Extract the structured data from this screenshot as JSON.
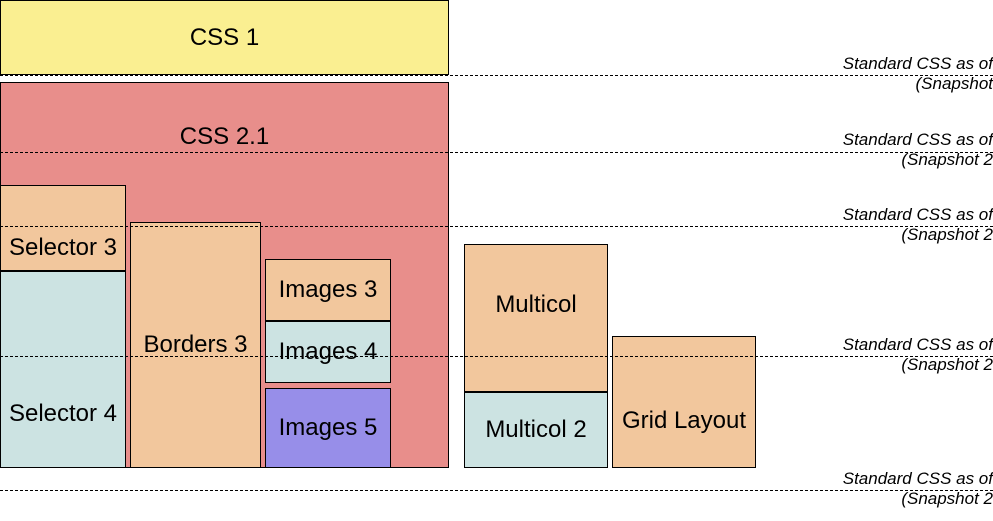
{
  "blocks": {
    "css1": "CSS 1",
    "css21": "CSS 2.1",
    "selector3": "Selector 3",
    "selector4": "Selector 4",
    "borders3": "Borders 3",
    "images3": "Images 3",
    "images4": "Images 4",
    "images5": "Images 5",
    "multicol": "Multicol",
    "multicol2": "Multicol 2",
    "gridlayout": "Grid Layout"
  },
  "labels": {
    "line1a": "Standard CSS as of",
    "line1b": "(Snapshot ",
    "line2a": "Standard CSS as of",
    "line2b": "(Snapshot 2",
    "line3a": "Standard CSS as of",
    "line3b": "(Snapshot 2",
    "line4a": "Standard CSS as of",
    "line4b": "(Snapshot 2",
    "line5a": "Standard CSS as of",
    "line5b": "(Snapshot 2"
  }
}
